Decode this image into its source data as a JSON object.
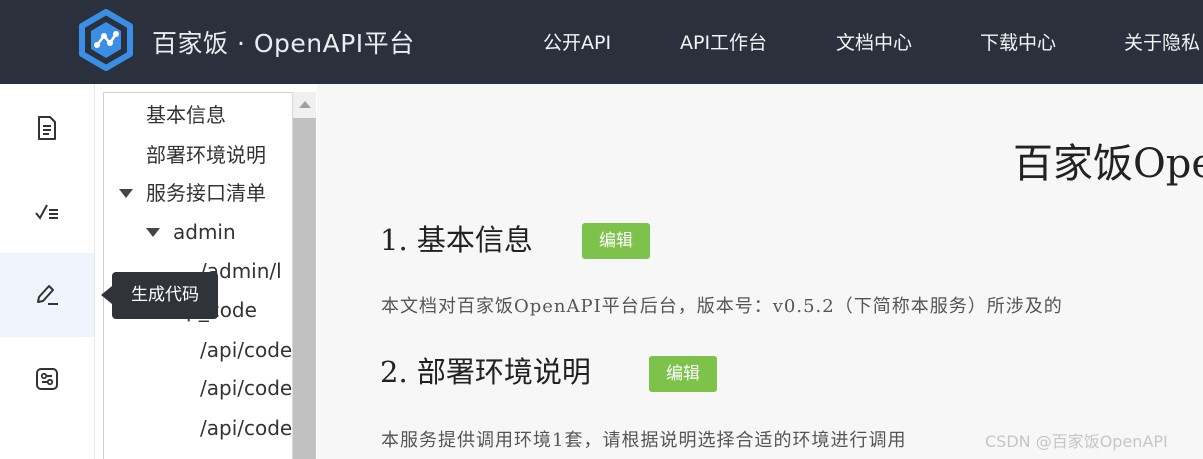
{
  "header": {
    "brand": "百家饭 · OpenAPI平台",
    "nav": [
      "公开API",
      "API工作台",
      "文档中心",
      "下载中心",
      "关于隐私"
    ]
  },
  "iconbar": {
    "items": [
      {
        "icon": "document-icon"
      },
      {
        "icon": "checklist-icon"
      },
      {
        "icon": "edit-pen-icon"
      },
      {
        "icon": "settings-sliders-icon"
      }
    ],
    "active_index": 2,
    "tooltip": "生成代码"
  },
  "tree": {
    "items": [
      {
        "label": "基本信息"
      },
      {
        "label": "部署环境说明"
      },
      {
        "label": "服务接口清单"
      },
      {
        "label": "admin"
      },
      {
        "label": "/admin/l"
      },
      {
        "label": "p_code"
      },
      {
        "label": "/api/code"
      },
      {
        "label": "/api/code"
      },
      {
        "label": "/api/code"
      }
    ]
  },
  "doc": {
    "title": "百家饭Ope",
    "sections": [
      {
        "heading": "1.  基本信息",
        "edit_label": "编辑",
        "text": "本文档对百家饭OpenAPI平台后台，版本号：v0.5.2（下简称本服务）所涉及的"
      },
      {
        "heading": "2.  部署环境说明",
        "edit_label": "编辑",
        "text": "本服务提供调用环境1套，请根据说明选择合适的环境进行调用"
      }
    ]
  },
  "watermark": "CSDN @百家饭OpenAPI",
  "colors": {
    "topbar_bg": "#2b313c",
    "accent_green": "#7dc24b",
    "logo_blue": "#3a8ee6",
    "tooltip_bg": "#30343a"
  }
}
